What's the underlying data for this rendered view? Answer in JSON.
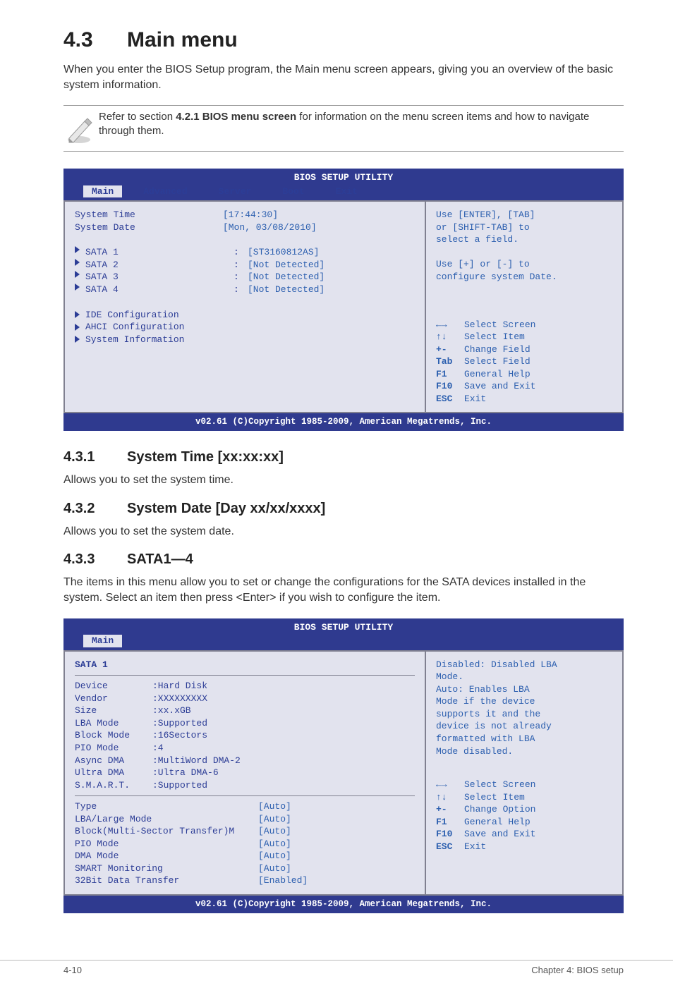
{
  "h1": {
    "num": "4.3",
    "title": "Main menu"
  },
  "intro": "When you enter the BIOS Setup program, the Main menu screen appears, giving you an overview of the basic system information.",
  "note": {
    "pre": "Refer to section ",
    "bold": "4.2.1 BIOS menu screen",
    "post": " for information on the menu screen items and how to navigate through them."
  },
  "bios1": {
    "title": "BIOS SETUP UTILITY",
    "tabs": [
      "Main",
      "Advanced",
      "Server",
      "Boot",
      "Exit"
    ],
    "rows": [
      {
        "lbl": "System Time",
        "val": "[17:44:30]"
      },
      {
        "lbl": "System Date",
        "val": "[Mon, 03/08/2010]"
      }
    ],
    "sata": [
      {
        "lbl": "SATA 1",
        "sep": ":",
        "val": "[ST3160812AS]"
      },
      {
        "lbl": "SATA 2",
        "sep": ":",
        "val": "[Not Detected]"
      },
      {
        "lbl": "SATA 3",
        "sep": ":",
        "val": "[Not Detected]"
      },
      {
        "lbl": "SATA 4",
        "sep": ":",
        "val": "[Not Detected]"
      }
    ],
    "menus": [
      "IDE Configuration",
      "AHCI Configuration",
      "System Information"
    ],
    "help_top": [
      "Use [ENTER], [TAB]",
      "or [SHIFT-TAB] to",
      "select a field.",
      "",
      "Use [+] or [-] to",
      "configure system Date."
    ],
    "help_keys": [
      {
        "k": "←→",
        "t": "Select Screen"
      },
      {
        "k": "↑↓",
        "t": "Select Item"
      },
      {
        "k": "+-",
        "t": "Change Field"
      },
      {
        "k": "Tab",
        "t": "Select Field"
      },
      {
        "k": "F1",
        "t": "General Help"
      },
      {
        "k": "F10",
        "t": "Save and Exit"
      },
      {
        "k": "ESC",
        "t": "Exit"
      }
    ],
    "footer": "v02.61 (C)Copyright 1985-2009, American Megatrends, Inc."
  },
  "s431": {
    "num": "4.3.1",
    "title": "System Time [xx:xx:xx]",
    "text": "Allows you to set the system time."
  },
  "s432": {
    "num": "4.3.2",
    "title": "System Date [Day xx/xx/xxxx]",
    "text": "Allows you to set the system date."
  },
  "s433": {
    "num": "4.3.3",
    "title": "SATA1—4",
    "text": "The items in this menu allow you to set or change the configurations for the SATA devices installed in the system. Select an item then press <Enter> if you wish to configure the item."
  },
  "bios2": {
    "title": "BIOS SETUP UTILITY",
    "tab": "Main",
    "heading": "SATA 1",
    "dev": [
      {
        "k": "Device",
        "v": ":Hard Disk"
      },
      {
        "k": "Vendor",
        "v": ":XXXXXXXXX"
      },
      {
        "k": "Size",
        "v": ":xx.xGB"
      },
      {
        "k": "LBA Mode",
        "v": ":Supported"
      },
      {
        "k": "Block Mode",
        "v": ":16Sectors"
      },
      {
        "k": "PIO Mode",
        "v": ":4"
      },
      {
        "k": "Async DMA",
        "v": ":MultiWord DMA-2"
      },
      {
        "k": "Ultra DMA",
        "v": ":Ultra DMA-6"
      },
      {
        "k": "S.M.A.R.T.",
        "v": ":Supported"
      }
    ],
    "opts": [
      {
        "lbl": "Type",
        "val": "[Auto]"
      },
      {
        "lbl": "LBA/Large Mode",
        "val": "[Auto]"
      },
      {
        "lbl": "Block(Multi-Sector Transfer)M",
        "val": "[Auto]"
      },
      {
        "lbl": "PIO Mode",
        "val": "[Auto]"
      },
      {
        "lbl": "DMA Mode",
        "val": "[Auto]"
      },
      {
        "lbl": "SMART Monitoring",
        "val": "[Auto]"
      },
      {
        "lbl": "32Bit Data Transfer",
        "val": "[Enabled]"
      }
    ],
    "help_top": [
      "Disabled: Disabled LBA",
      "Mode.",
      "Auto: Enables LBA",
      "Mode if the device",
      "supports it and the",
      "device is not already",
      "formatted with LBA",
      "Mode disabled."
    ],
    "help_keys": [
      {
        "k": "←→",
        "t": "Select Screen"
      },
      {
        "k": "↑↓",
        "t": "Select Item"
      },
      {
        "k": "+-",
        "t": "Change Option"
      },
      {
        "k": "F1",
        "t": "General Help"
      },
      {
        "k": "F10",
        "t": "Save and Exit"
      },
      {
        "k": "ESC",
        "t": "Exit"
      }
    ],
    "footer": "v02.61 (C)Copyright 1985-2009, American Megatrends, Inc."
  },
  "footer": {
    "left": "4-10",
    "right": "Chapter 4: BIOS setup"
  }
}
